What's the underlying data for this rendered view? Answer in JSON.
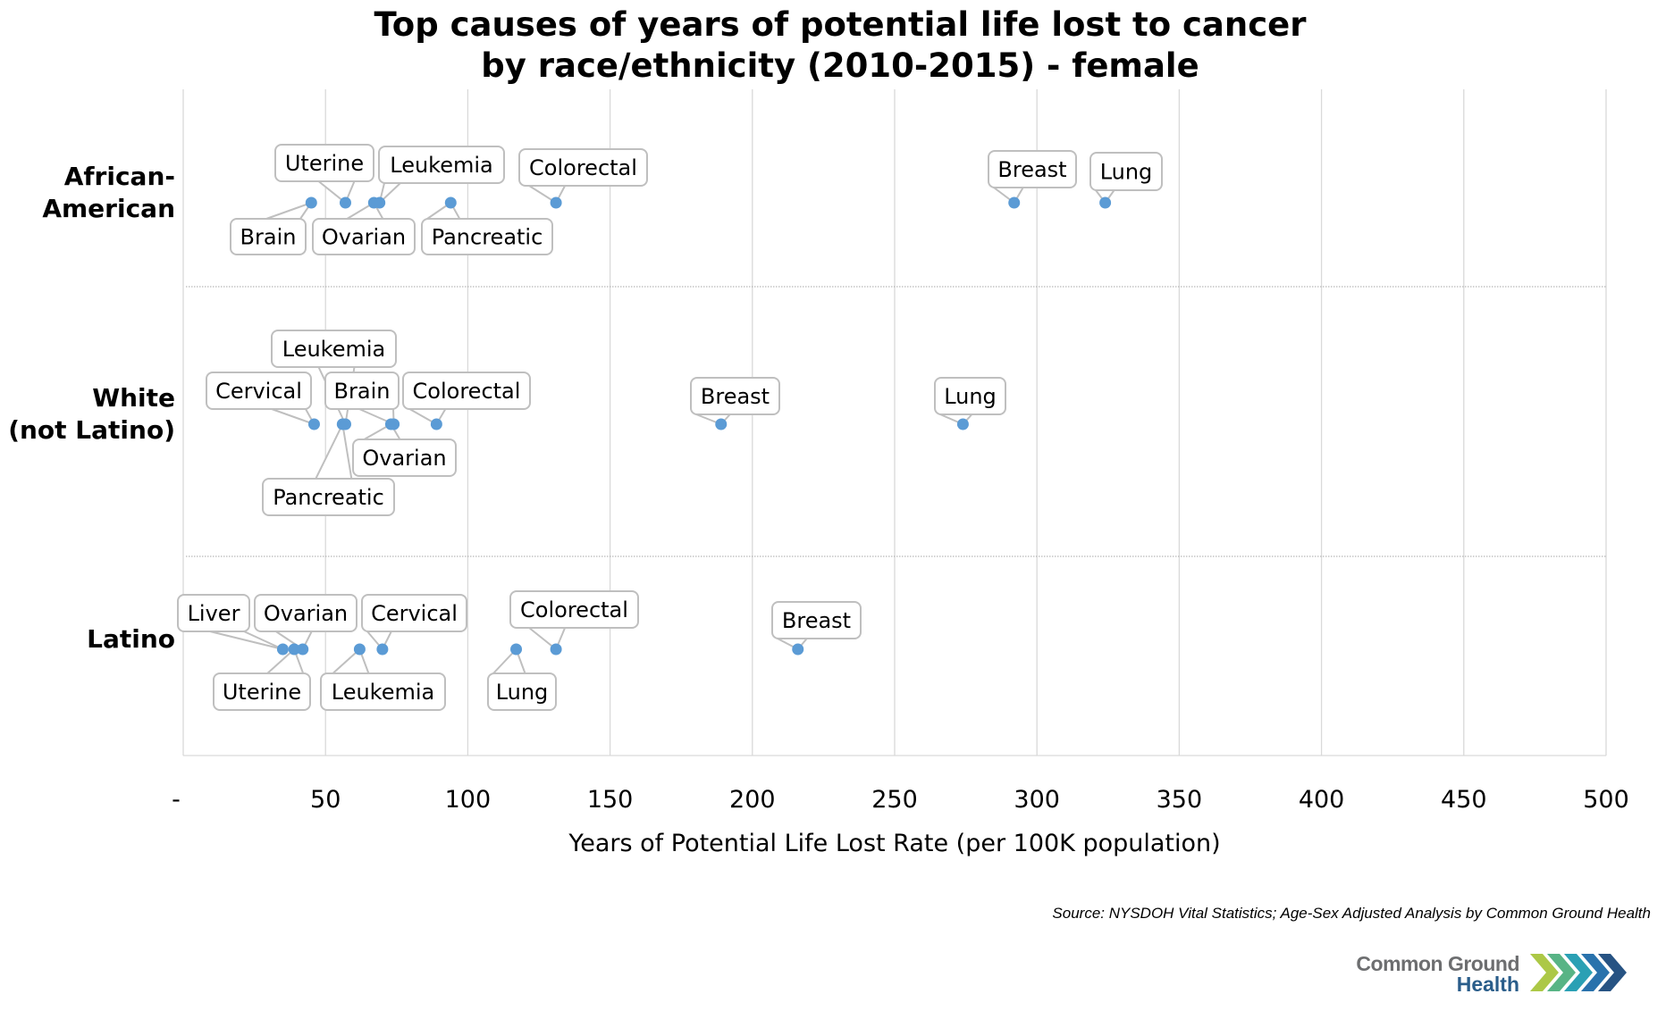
{
  "chart_data": {
    "type": "scatter",
    "title_lines": [
      "Top causes of years of potential life lost to cancer",
      "by race/ethnicity (2010-2015) - female"
    ],
    "xlabel": "Years of Potential Life Lost Rate (per 100K population)",
    "ylabel": "",
    "xlim": [
      0,
      500
    ],
    "x_ticks": [
      0,
      50,
      100,
      150,
      200,
      250,
      300,
      350,
      400,
      450,
      500
    ],
    "x_tick_labels": [
      "-",
      "50",
      "100",
      "150",
      "200",
      "250",
      "300",
      "350",
      "400",
      "450",
      "500"
    ],
    "grid": "vertical",
    "legend": "none",
    "categories": [
      "African-American",
      "White (not Latino)",
      "Latino"
    ],
    "category_label_lines": [
      [
        "African-",
        "American"
      ],
      [
        "White",
        "(not Latino)"
      ],
      [
        "Latino"
      ]
    ],
    "marker_color": "#5b9bd5",
    "series": [
      {
        "name": "African-American",
        "points": [
          {
            "label": "Brain",
            "x": 45
          },
          {
            "label": "Uterine",
            "x": 57
          },
          {
            "label": "Ovarian",
            "x": 67
          },
          {
            "label": "Leukemia",
            "x": 69
          },
          {
            "label": "Pancreatic",
            "x": 94
          },
          {
            "label": "Colorectal",
            "x": 131
          },
          {
            "label": "Breast",
            "x": 292
          },
          {
            "label": "Lung",
            "x": 324
          }
        ]
      },
      {
        "name": "White (not Latino)",
        "points": [
          {
            "label": "Cervical",
            "x": 46
          },
          {
            "label": "Pancreatic",
            "x": 56
          },
          {
            "label": "Leukemia",
            "x": 57
          },
          {
            "label": "Ovarian",
            "x": 73
          },
          {
            "label": "Brain",
            "x": 74
          },
          {
            "label": "Colorectal",
            "x": 89
          },
          {
            "label": "Breast",
            "x": 189
          },
          {
            "label": "Lung",
            "x": 274
          }
        ]
      },
      {
        "name": "Latino",
        "points": [
          {
            "label": "Liver",
            "x": 35
          },
          {
            "label": "Uterine",
            "x": 39
          },
          {
            "label": "Ovarian",
            "x": 42
          },
          {
            "label": "Leukemia",
            "x": 62
          },
          {
            "label": "Cervical",
            "x": 70
          },
          {
            "label": "Lung",
            "x": 117
          },
          {
            "label": "Colorectal",
            "x": 131
          },
          {
            "label": "Breast",
            "x": 216
          }
        ]
      }
    ],
    "source": "Source: NYSDOH Vital Statistics; Age-Sex Adjusted Analysis by Common Ground Health"
  },
  "logo": {
    "line1": "Common Ground",
    "line2": "Health",
    "icon": "chevrons-icon",
    "colors": [
      "#a8c53c",
      "#4fb07e",
      "#1f9bb0",
      "#1e6aa8",
      "#1b4a7c"
    ]
  }
}
